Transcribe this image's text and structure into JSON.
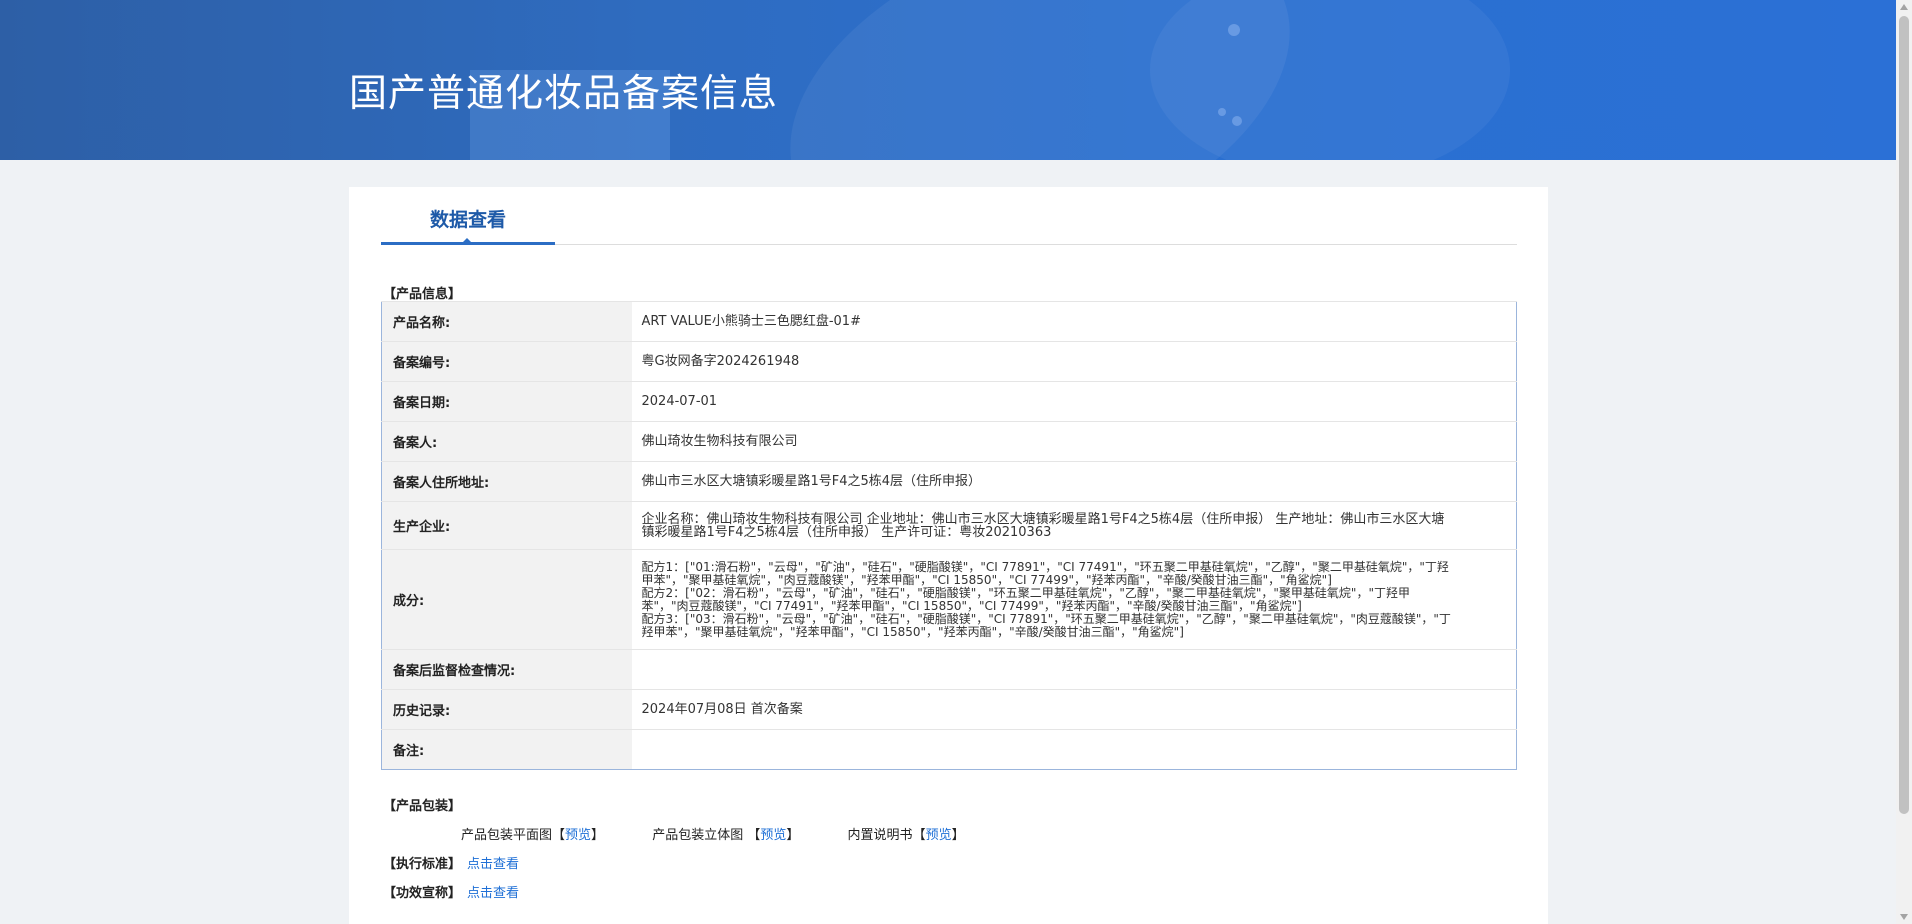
{
  "header": {
    "title": "国产普通化妆品备案信息"
  },
  "tab": {
    "label": "数据查看"
  },
  "product_info": {
    "section_title": "【产品信息】",
    "rows": [
      {
        "label": "产品名称:",
        "value": "ART VALUE小熊骑士三色腮红盘-01#"
      },
      {
        "label": "备案编号:",
        "value": "粤G妆网备字2024261948"
      },
      {
        "label": "备案日期:",
        "value": "2024-07-01"
      },
      {
        "label": "备案人:",
        "value": "佛山琦妆生物科技有限公司"
      },
      {
        "label": "备案人住所地址:",
        "value": "佛山市三水区大塘镇彩暖星路1号F4之5栋4层（住所申报）"
      },
      {
        "label": "生产企业:",
        "value": "企业名称：佛山琦妆生物科技有限公司 企业地址：佛山市三水区大塘镇彩暖星路1号F4之5栋4层（住所申报） 生产地址：佛山市三水区大塘镇彩暖星路1号F4之5栋4层（住所申报） 生产许可证：粤妆20210363"
      },
      {
        "label": "成分:",
        "value": "配方1：[\"01:滑石粉\"，\"云母\"，\"矿油\"，\"硅石\"，\"硬脂酸镁\"，\"CI 77891\"，\"CI 77491\"，\"环五聚二甲基硅氧烷\"，\"乙醇\"，\"聚二甲基硅氧烷\"，\"丁羟甲苯\"，\"聚甲基硅氧烷\"，\"肉豆蔻酸镁\"，\"羟苯甲酯\"，\"CI 15850\"，\"CI 77499\"，\"羟苯丙酯\"，\"辛酸/癸酸甘油三酯\"，\"角鲨烷\"]\n配方2：[\"02：滑石粉\"，\"云母\"，\"矿油\"，\"硅石\"，\"硬脂酸镁\"，\"环五聚二甲基硅氧烷\"，\"乙醇\"，\"聚二甲基硅氧烷\"，\"聚甲基硅氧烷\"，\"丁羟甲苯\"，\"肉豆蔻酸镁\"，\"CI 77491\"，\"羟苯甲酯\"，\"CI 15850\"，\"CI 77499\"，\"羟苯丙酯\"，\"辛酸/癸酸甘油三酯\"，\"角鲨烷\"]\n配方3：[\"03：滑石粉\"，\"云母\"，\"矿油\"，\"硅石\"，\"硬脂酸镁\"，\"CI 77891\"，\"环五聚二甲基硅氧烷\"，\"乙醇\"，\"聚二甲基硅氧烷\"，\"肉豆蔻酸镁\"，\"丁羟甲苯\"，\"聚甲基硅氧烷\"，\"羟苯甲酯\"，\"CI 15850\"，\"羟苯丙酯\"，\"辛酸/癸酸甘油三酯\"，\"角鲨烷\"]"
      },
      {
        "label": "备案后监督检查情况:",
        "value": ""
      },
      {
        "label": "历史记录:",
        "value": "2024年07月08日 首次备案"
      },
      {
        "label": "备注:",
        "value": ""
      }
    ]
  },
  "packaging": {
    "section_title": "【产品包装】",
    "items": [
      {
        "label": "产品包装平面图",
        "bracket_open": "【",
        "link": "预览",
        "bracket_close": "】"
      },
      {
        "label": "产品包装立体图",
        "bracket_open": "【",
        "link": "预览",
        "bracket_close": "】"
      },
      {
        "label": "内置说明书",
        "bracket_open": "【",
        "link": "预览",
        "bracket_close": "】"
      }
    ]
  },
  "standard": {
    "label": "【执行标准】",
    "link": "点击查看"
  },
  "efficacy": {
    "label": "【功效宣称】",
    "link": "点击查看"
  },
  "colors": {
    "accent": "#2b6dc4",
    "link": "#1e6fd6",
    "banner": "#2f6cc0"
  }
}
